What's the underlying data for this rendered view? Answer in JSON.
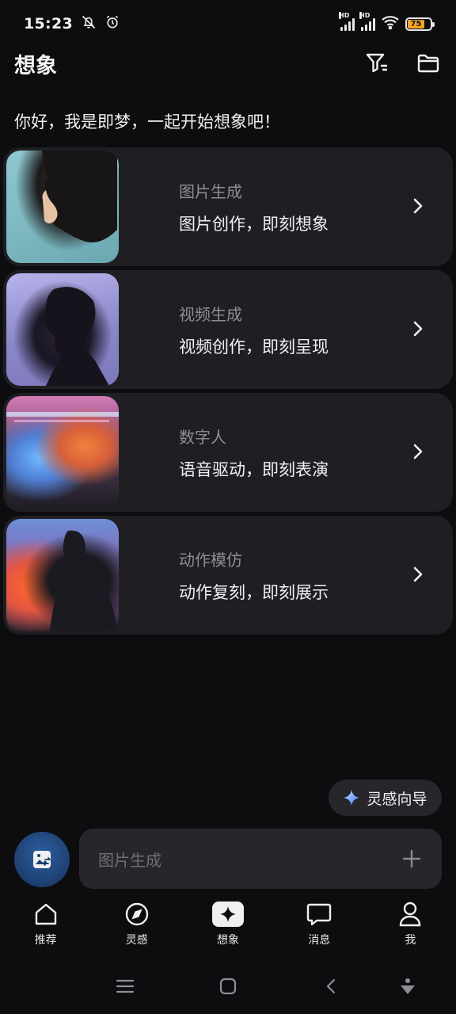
{
  "status_bar": {
    "time": "15:23",
    "network_1": "HD",
    "network_2": "HD",
    "battery_percent": "75"
  },
  "header": {
    "title": "想象"
  },
  "greeting": "你好，我是即梦，一起开始想象吧！",
  "cards": [
    {
      "title": "图片生成",
      "subtitle": "图片创作，即刻想象"
    },
    {
      "title": "视频生成",
      "subtitle": "视频创作，即刻呈现"
    },
    {
      "title": "数字人",
      "subtitle": "语音驱动，即刻表演"
    },
    {
      "title": "动作模仿",
      "subtitle": "动作复刻，即刻展示"
    }
  ],
  "inspire_button": {
    "label": "灵感向导"
  },
  "composer": {
    "placeholder": "图片生成"
  },
  "tabs": [
    {
      "label": "推荐",
      "icon": "home-icon"
    },
    {
      "label": "灵感",
      "icon": "compass-icon"
    },
    {
      "label": "想象",
      "icon": "sparkle-icon"
    },
    {
      "label": "消息",
      "icon": "chat-bubble-icon"
    },
    {
      "label": "我",
      "icon": "person-icon"
    }
  ],
  "colors": {
    "background": "#0d0d0f",
    "card": "#1f1f23",
    "accent_blue": "#2c5fa0",
    "battery": "#f5a623"
  }
}
